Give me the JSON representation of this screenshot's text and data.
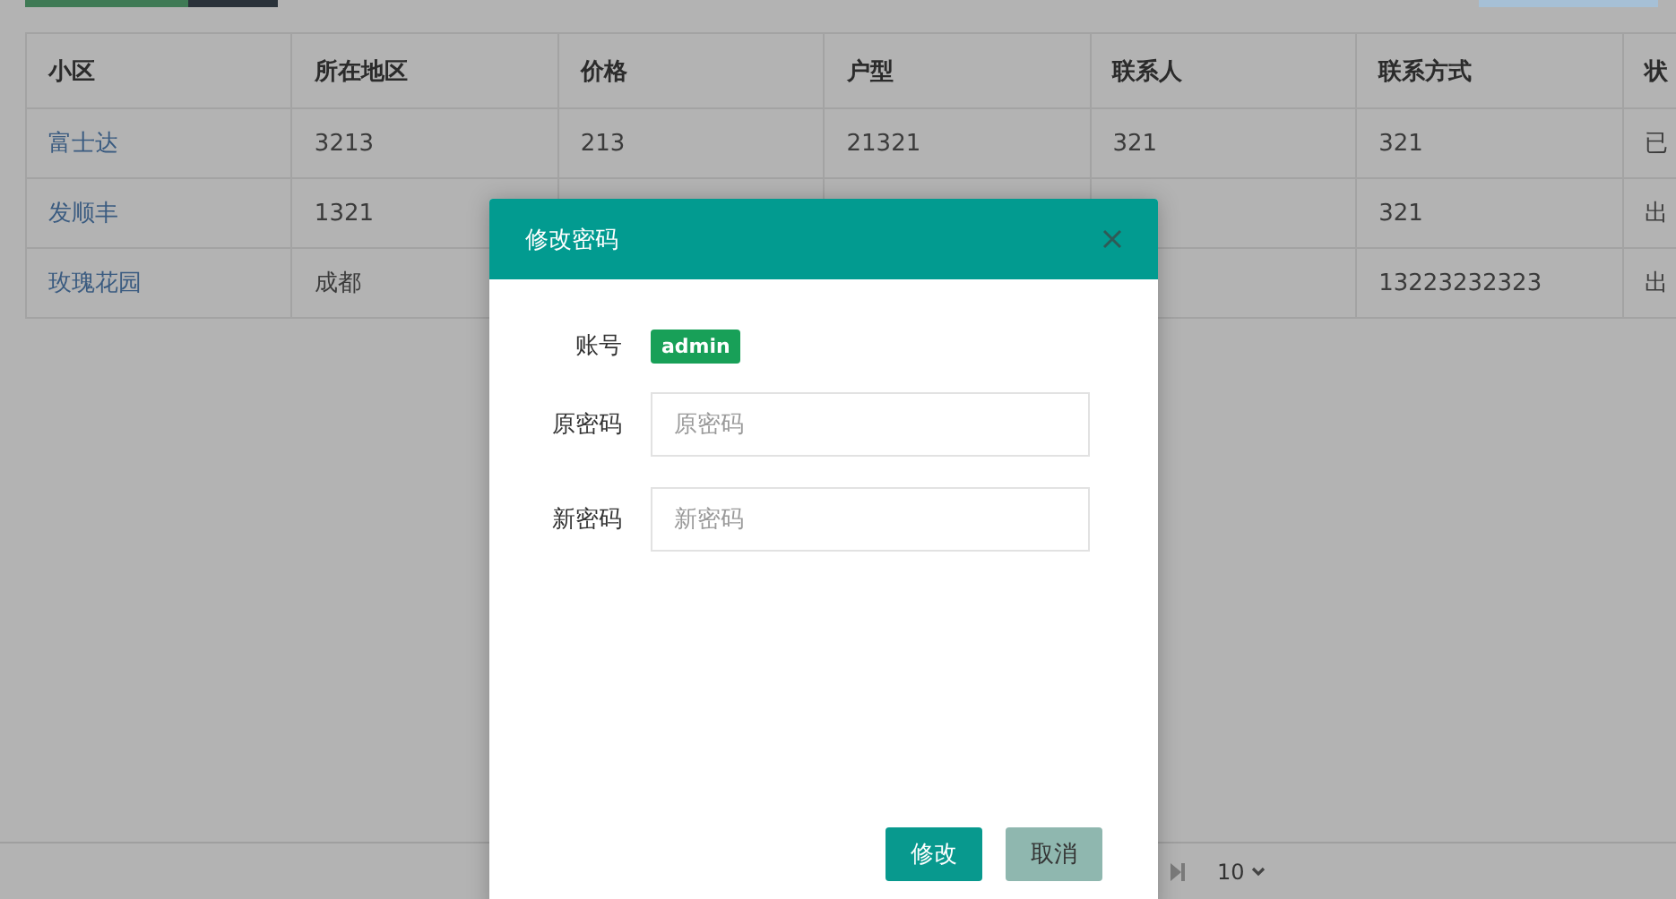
{
  "toolbar": {
    "buttons": [
      {
        "kind": "success"
      },
      {
        "kind": "dark"
      },
      {
        "kind": "info"
      }
    ]
  },
  "table": {
    "columns": [
      "小区",
      "所在地区",
      "价格",
      "户型",
      "联系人",
      "联系方式",
      "状"
    ],
    "rows": [
      {
        "cells": [
          "富士达",
          "3213",
          "213",
          "21321",
          "321",
          "321",
          "已"
        ]
      },
      {
        "cells": [
          "发顺丰",
          "1321",
          null,
          null,
          null,
          "321",
          "出"
        ]
      },
      {
        "cells": [
          "玫瑰花园",
          "成都",
          null,
          null,
          null,
          "13223232323",
          "出"
        ]
      }
    ]
  },
  "pagination": {
    "page_size": "10"
  },
  "dialog": {
    "title": "修改密码",
    "account_label": "账号",
    "account": "admin",
    "fields": [
      {
        "label": "原密码",
        "placeholder": "原密码"
      },
      {
        "label": "新密码",
        "placeholder": "新密码"
      }
    ],
    "buttons": [
      {
        "label": "修改",
        "kind": "primary"
      },
      {
        "label": "取消",
        "kind": "secondary"
      }
    ]
  }
}
